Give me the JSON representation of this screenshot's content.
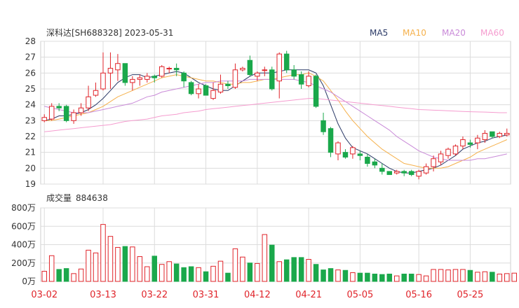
{
  "header": {
    "title": "深科达[SH688328] 2023-05-31",
    "legend": [
      {
        "label": "MA5",
        "color": "#2b3a67"
      },
      {
        "label": "MA10",
        "color": "#f5b14c"
      },
      {
        "label": "MA20",
        "color": "#c98ad8"
      },
      {
        "label": "MA60",
        "color": "#f59ccf"
      }
    ]
  },
  "volume_header": {
    "label": "成交量",
    "value": "884638"
  },
  "colors": {
    "up": "#e0242a",
    "down": "#1aa84b",
    "grid": "#dcdcdc",
    "axis_text": "#333333",
    "date_text": "#e0242a"
  },
  "chart_data": [
    {
      "type": "candlestick",
      "ylim": [
        19,
        28
      ],
      "yticks": [
        "28",
        "27",
        "26",
        "25",
        "24",
        "23",
        "22",
        "21",
        "20",
        "19"
      ],
      "x_tick_labels": [
        {
          "label": "03-02",
          "index": 0
        },
        {
          "label": "03-13",
          "index": 8
        },
        {
          "label": "03-22",
          "index": 15
        },
        {
          "label": "03-31",
          "index": 22
        },
        {
          "label": "04-12",
          "index": 29
        },
        {
          "label": "04-21",
          "index": 36
        },
        {
          "label": "05-05",
          "index": 43
        },
        {
          "label": "05-16",
          "index": 51
        },
        {
          "label": "05-25",
          "index": 58
        }
      ],
      "ohlc": [
        [
          23.0,
          23.2,
          22.9,
          23.4
        ],
        [
          23.1,
          23.9,
          23.0,
          24.1
        ],
        [
          23.9,
          23.8,
          23.6,
          24.1
        ],
        [
          23.9,
          23.0,
          22.9,
          24.0
        ],
        [
          23.0,
          23.5,
          22.8,
          23.7
        ],
        [
          23.5,
          23.8,
          23.3,
          24.1
        ],
        [
          23.8,
          24.5,
          23.6,
          25.2
        ],
        [
          24.6,
          24.9,
          24.5,
          25.4
        ],
        [
          25.0,
          26.0,
          24.9,
          27.3
        ],
        [
          26.0,
          26.3,
          25.0,
          27.3
        ],
        [
          26.2,
          26.6,
          25.5,
          27.2
        ],
        [
          26.6,
          25.4,
          25.2,
          26.6
        ],
        [
          25.4,
          25.6,
          24.9,
          25.8
        ],
        [
          25.6,
          25.7,
          25.2,
          25.9
        ],
        [
          25.6,
          25.8,
          25.4,
          26.0
        ],
        [
          25.8,
          25.7,
          25.4,
          25.9
        ],
        [
          25.8,
          26.4,
          25.7,
          26.5
        ],
        [
          26.3,
          26.3,
          26.0,
          26.4
        ],
        [
          26.3,
          26.2,
          25.8,
          26.6
        ],
        [
          26.0,
          25.5,
          25.1,
          26.1
        ],
        [
          25.4,
          24.7,
          24.6,
          25.5
        ],
        [
          24.7,
          25.0,
          24.4,
          25.3
        ],
        [
          25.2,
          24.6,
          24.6,
          25.3
        ],
        [
          24.4,
          24.9,
          24.3,
          25.4
        ],
        [
          24.8,
          25.3,
          24.7,
          25.9
        ],
        [
          25.3,
          25.2,
          25.0,
          25.5
        ],
        [
          25.1,
          26.2,
          25.0,
          26.6
        ],
        [
          26.2,
          26.3,
          26.1,
          26.4
        ],
        [
          26.8,
          25.9,
          25.8,
          27.1
        ],
        [
          25.8,
          26.0,
          25.5,
          26.1
        ],
        [
          26.2,
          26.2,
          25.8,
          26.4
        ],
        [
          26.2,
          25.0,
          24.9,
          26.4
        ],
        [
          25.5,
          27.2,
          24.4,
          27.3
        ],
        [
          27.2,
          26.2,
          26.0,
          27.4
        ],
        [
          26.2,
          25.8,
          25.6,
          26.5
        ],
        [
          25.9,
          25.3,
          25.0,
          26.1
        ],
        [
          25.2,
          25.8,
          25.1,
          26.1
        ],
        [
          25.8,
          23.9,
          23.8,
          25.9
        ],
        [
          23.0,
          22.3,
          22.1,
          23.5
        ],
        [
          22.5,
          21.0,
          20.7,
          22.6
        ],
        [
          20.9,
          21.6,
          20.5,
          21.7
        ],
        [
          21.0,
          20.7,
          20.6,
          21.2
        ],
        [
          20.9,
          21.3,
          20.6,
          21.4
        ],
        [
          20.9,
          20.8,
          20.5,
          21.1
        ],
        [
          20.7,
          20.3,
          20.1,
          20.9
        ],
        [
          20.4,
          20.2,
          20.0,
          20.6
        ],
        [
          20.0,
          19.8,
          19.6,
          20.3
        ],
        [
          19.8,
          19.6,
          19.6,
          19.8
        ],
        [
          19.7,
          19.8,
          19.6,
          19.9
        ],
        [
          19.8,
          19.7,
          19.5,
          19.9
        ],
        [
          19.8,
          19.6,
          19.5,
          19.9
        ],
        [
          19.5,
          19.8,
          19.3,
          19.9
        ],
        [
          19.7,
          20.1,
          19.6,
          20.3
        ],
        [
          20.1,
          20.6,
          19.8,
          20.8
        ],
        [
          20.4,
          20.9,
          20.2,
          21.1
        ],
        [
          20.8,
          21.2,
          20.6,
          21.3
        ],
        [
          20.9,
          21.4,
          20.8,
          21.5
        ],
        [
          21.4,
          21.8,
          21.2,
          22.0
        ],
        [
          21.6,
          21.5,
          21.3,
          21.8
        ],
        [
          21.6,
          21.9,
          21.2,
          22.1
        ],
        [
          21.8,
          22.2,
          21.6,
          22.4
        ],
        [
          22.3,
          22.0,
          21.9,
          22.3
        ],
        [
          22.0,
          22.2,
          21.9,
          22.3
        ],
        [
          22.1,
          22.2,
          22.0,
          22.5
        ]
      ],
      "series": [
        {
          "name": "MA5",
          "color": "#2b3a67",
          "values": [
            23.0,
            23.1,
            23.3,
            23.3,
            23.4,
            23.5,
            23.7,
            24.0,
            24.4,
            24.9,
            25.4,
            25.7,
            25.9,
            25.9,
            25.7,
            25.8,
            25.9,
            26.0,
            26.1,
            26.0,
            25.7,
            25.4,
            25.2,
            25.0,
            24.9,
            24.9,
            25.2,
            25.5,
            25.8,
            26.0,
            26.0,
            26.0,
            26.1,
            26.2,
            26.2,
            26.2,
            26.2,
            26.0,
            25.2,
            24.0,
            22.8,
            21.9,
            21.3,
            21.1,
            20.9,
            20.6,
            20.3,
            20.0,
            19.8,
            19.7,
            19.7,
            19.8,
            19.9,
            20.0,
            20.2,
            20.5,
            20.8,
            21.2,
            21.4,
            21.6,
            21.7,
            21.9,
            22.0,
            22.1
          ]
        },
        {
          "name": "MA10",
          "color": "#f5b14c",
          "values": [
            23.0,
            23.0,
            23.1,
            23.2,
            23.3,
            23.4,
            23.5,
            23.7,
            23.9,
            24.2,
            24.5,
            24.7,
            24.9,
            25.1,
            25.3,
            25.5,
            25.7,
            25.8,
            25.9,
            25.8,
            25.7,
            25.6,
            25.5,
            25.5,
            25.4,
            25.3,
            25.3,
            25.4,
            25.4,
            25.5,
            25.6,
            25.6,
            25.7,
            25.8,
            25.9,
            25.9,
            26.0,
            25.8,
            25.5,
            24.9,
            24.3,
            23.6,
            23.0,
            22.5,
            22.0,
            21.6,
            21.2,
            20.9,
            20.6,
            20.3,
            20.2,
            20.1,
            20.0,
            20.0,
            20.0,
            20.1,
            20.3,
            20.5,
            20.7,
            21.0,
            21.2,
            21.4,
            21.6,
            21.8
          ]
        },
        {
          "name": "MA20",
          "color": "#c98ad8",
          "values": [
            23.9,
            23.8,
            23.7,
            23.6,
            23.5,
            23.5,
            23.5,
            23.6,
            23.7,
            23.8,
            23.9,
            24.0,
            24.1,
            24.3,
            24.5,
            24.6,
            24.8,
            24.9,
            25.0,
            25.1,
            25.2,
            25.3,
            25.4,
            25.4,
            25.5,
            25.5,
            25.5,
            25.5,
            25.6,
            25.6,
            25.6,
            25.6,
            25.6,
            25.6,
            25.6,
            25.5,
            25.4,
            25.2,
            25.0,
            24.8,
            24.5,
            24.2,
            23.9,
            23.6,
            23.3,
            23.0,
            22.7,
            22.4,
            22.0,
            21.7,
            21.4,
            21.1,
            20.9,
            20.7,
            20.6,
            20.5,
            20.5,
            20.5,
            20.5,
            20.6,
            20.6,
            20.7,
            20.8,
            20.9
          ]
        },
        {
          "name": "MA60",
          "color": "#f59ccf",
          "values": [
            22.3,
            22.35,
            22.4,
            22.45,
            22.5,
            22.55,
            22.6,
            22.65,
            22.7,
            22.75,
            22.85,
            22.95,
            23.0,
            23.05,
            23.1,
            23.2,
            23.3,
            23.35,
            23.4,
            23.5,
            23.55,
            23.6,
            23.7,
            23.75,
            23.8,
            23.85,
            23.9,
            23.95,
            24.0,
            24.05,
            24.1,
            24.15,
            24.2,
            24.25,
            24.3,
            24.35,
            24.4,
            24.4,
            24.35,
            24.3,
            24.25,
            24.2,
            24.15,
            24.1,
            24.05,
            24.0,
            23.95,
            23.9,
            23.85,
            23.8,
            23.75,
            23.7,
            23.68,
            23.66,
            23.64,
            23.62,
            23.6,
            23.58,
            23.56,
            23.55,
            23.54,
            23.52,
            23.5,
            23.5
          ]
        }
      ]
    },
    {
      "type": "bar",
      "ylim": [
        0,
        800
      ],
      "yticks": [
        "800万",
        "600万",
        "400万",
        "200万",
        "0万"
      ],
      "values": [
        110,
        280,
        130,
        140,
        85,
        135,
        340,
        310,
        620,
        490,
        370,
        380,
        375,
        270,
        160,
        275,
        185,
        215,
        190,
        150,
        160,
        150,
        105,
        165,
        220,
        90,
        355,
        265,
        200,
        195,
        510,
        395,
        215,
        235,
        260,
        260,
        240,
        185,
        125,
        140,
        125,
        120,
        95,
        90,
        90,
        80,
        75,
        80,
        60,
        80,
        80,
        75,
        60,
        130,
        130,
        125,
        130,
        130,
        120,
        100,
        105,
        100,
        80,
        85,
        90
      ]
    }
  ]
}
